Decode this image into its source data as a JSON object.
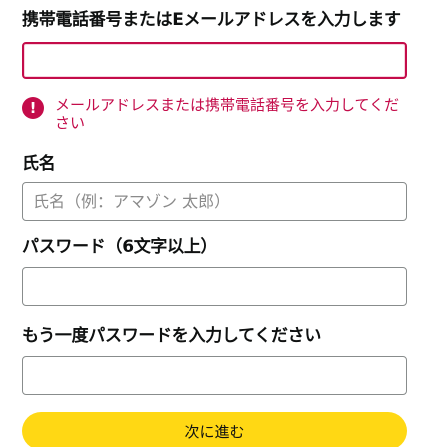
{
  "form": {
    "contact_label": "携帯電話番号またはEメールアドレスを入力します",
    "contact_value": "",
    "contact_error": "メールアドレスまたは携帯電話番号を入力してください",
    "error_icon_glyph": "!",
    "name_label": "氏名",
    "name_placeholder": "氏名（例：アマゾン 太郎）",
    "password_label": "パスワード（6文字以上）",
    "password_confirm_label": "もう一度パスワードを入力してください",
    "submit_label": "次に進む"
  },
  "colors": {
    "error": "#c40c4a",
    "button": "#ffd814"
  }
}
